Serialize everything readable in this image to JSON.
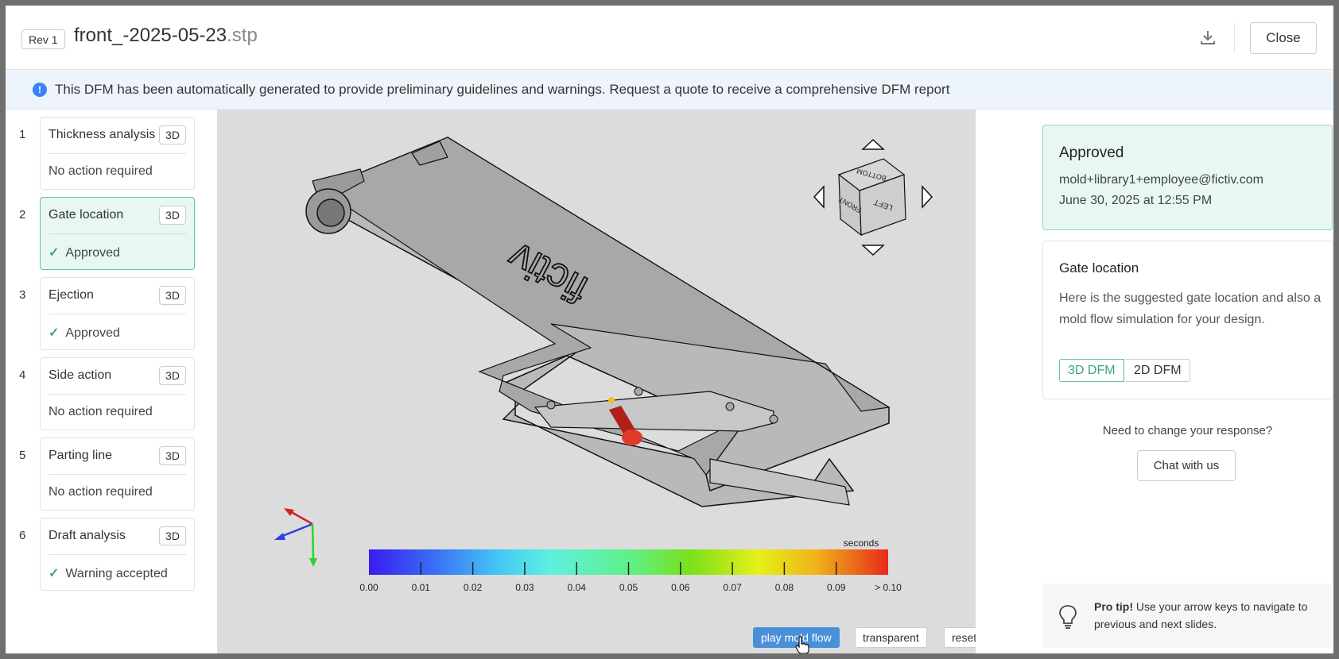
{
  "header": {
    "rev": "Rev 1",
    "filename": "front_-2025-05-23",
    "ext": ".stp",
    "close_label": "Close"
  },
  "banner": {
    "icon": "info-icon",
    "text": "This DFM has been automatically generated to provide preliminary guidelines and warnings. Request a quote to receive a comprehensive DFM report"
  },
  "steps": [
    {
      "num": "1",
      "title": "Thickness analysis",
      "badge": "3D",
      "status": "No action required",
      "check": false,
      "active": false
    },
    {
      "num": "2",
      "title": "Gate location",
      "badge": "3D",
      "status": "Approved",
      "check": true,
      "active": true
    },
    {
      "num": "3",
      "title": "Ejection",
      "badge": "3D",
      "status": "Approved",
      "check": true,
      "active": false
    },
    {
      "num": "4",
      "title": "Side action",
      "badge": "3D",
      "status": "No action required",
      "check": false,
      "active": false
    },
    {
      "num": "5",
      "title": "Parting line",
      "badge": "3D",
      "status": "No action required",
      "check": false,
      "active": false
    },
    {
      "num": "6",
      "title": "Draft analysis",
      "badge": "3D",
      "status": "Warning accepted",
      "check": true,
      "active": false
    }
  ],
  "viewer": {
    "cube": {
      "top": "BOTTOM",
      "front": "FRONT",
      "side": "LEFT"
    },
    "part_text": "fictiv",
    "scale_unit": "seconds",
    "scale_ticks": [
      "0.00",
      "0.01",
      "0.02",
      "0.03",
      "0.04",
      "0.05",
      "0.06",
      "0.07",
      "0.08",
      "0.09",
      "> 0.10"
    ],
    "buttons": {
      "play": "play mold flow",
      "transparent": "transparent",
      "reset": "reset view"
    }
  },
  "approval": {
    "title": "Approved",
    "email": "mold+library1+employee@fictiv.com",
    "date": "June 30, 2025 at 12:55 PM"
  },
  "gate": {
    "title": "Gate location",
    "description": "Here is the suggested gate location and also a mold flow simulation for your design.",
    "tab_3d": "3D DFM",
    "tab_2d": "2D DFM"
  },
  "help": {
    "prompt": "Need to change your response?",
    "chat": "Chat with us"
  },
  "tip": {
    "bold": "Pro tip!",
    "text": " Use your arrow keys to navigate to previous and next slides."
  },
  "colors": {
    "accent_green": "#3aa57f",
    "primary_blue": "#4a90d9",
    "approved_bg": "#e8f8f1"
  }
}
